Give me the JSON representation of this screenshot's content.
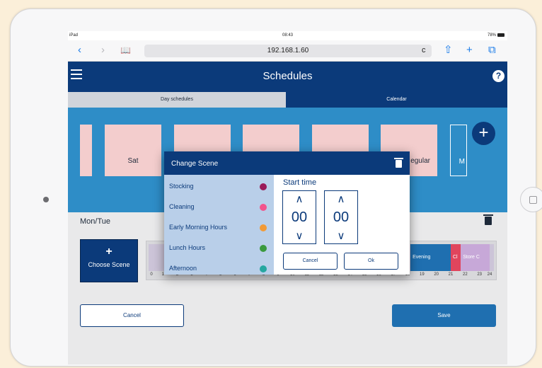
{
  "status_bar": {
    "device": "iPad",
    "time": "08:43",
    "battery": "78%"
  },
  "browser": {
    "url": "192.168.1.60",
    "back": "‹",
    "forward": "›",
    "bookmarks": "📖",
    "reload": "c",
    "share": "⇧",
    "new_tab": "+",
    "tabs": "⧉"
  },
  "header": {
    "title": "Schedules",
    "help_label": "?"
  },
  "tabs": [
    {
      "label": "Day schedules",
      "active": true
    },
    {
      "label": "Calendar",
      "active": false
    }
  ],
  "day_cards": [
    "",
    "Sat",
    "",
    "",
    "",
    "egular",
    "M"
  ],
  "add_label": "+",
  "day": {
    "label": "Mon/Tue"
  },
  "choose_scene": {
    "plus": "+",
    "label": "Choose Scene"
  },
  "timeline": {
    "segments": [
      {
        "label": "Evening",
        "color": "#1f6fb0",
        "start": 18.2,
        "end": 21.0
      },
      {
        "label": "Cl",
        "color": "#e0455d",
        "start": 21.0,
        "end": 21.7
      },
      {
        "label": "Store C",
        "color": "#c7a8d8",
        "start": 21.7,
        "end": 23.7
      }
    ],
    "hours": [
      "0",
      "1",
      "2",
      "3",
      "4",
      "5",
      "6",
      "7",
      "8",
      "9",
      "10",
      "11",
      "12",
      "13",
      "14",
      "15",
      "16",
      "17",
      "18",
      "19",
      "20",
      "21",
      "22",
      "23",
      "24"
    ]
  },
  "buttons": {
    "cancel": "Cancel",
    "save": "Save"
  },
  "modal": {
    "title": "Change Scene",
    "scenes": [
      {
        "name": "Stocking",
        "color": "#9a1a58"
      },
      {
        "name": "Cleaning",
        "color": "#f2548c"
      },
      {
        "name": "Early Morning Hours",
        "color": "#f29a36"
      },
      {
        "name": "Lunch Hours",
        "color": "#3a9a3e"
      },
      {
        "name": "Afternoon",
        "color": "#26a7a0"
      }
    ],
    "start_time_label": "Start time",
    "hours_value": "00",
    "minutes_value": "00",
    "up_arrow": "∧",
    "down_arrow": "∨",
    "cancel_label": "Cancel",
    "ok_label": "Ok"
  }
}
